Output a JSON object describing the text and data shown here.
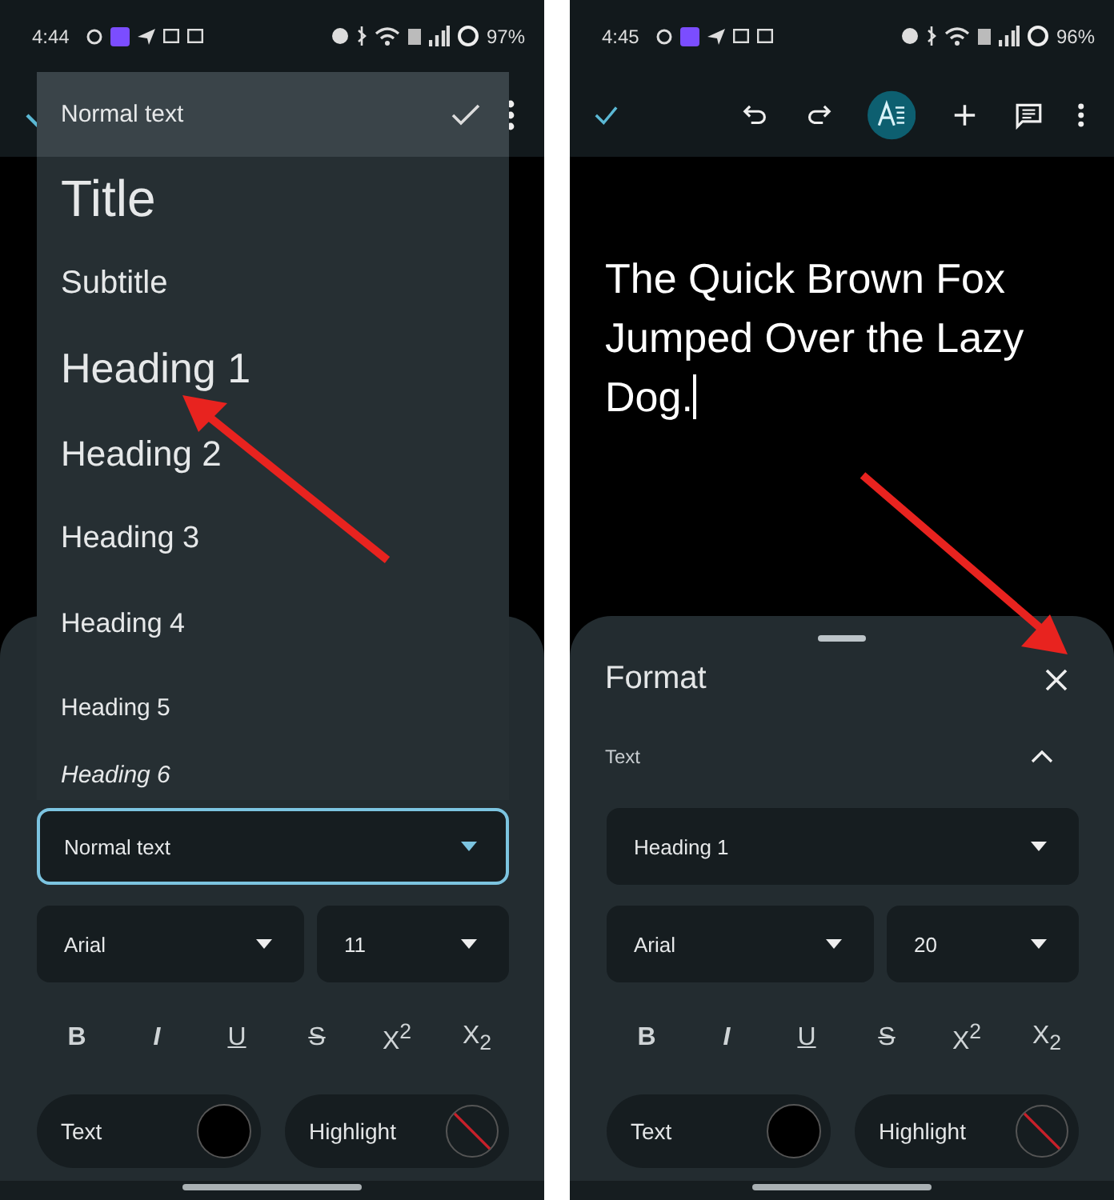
{
  "screens": [
    {
      "status_bar": {
        "time": "4:44",
        "battery": "97%"
      },
      "toolbar": {
        "kind": "covered"
      },
      "style_menu": {
        "items": [
          {
            "label": "Normal text",
            "kind": "normal",
            "selected": true
          },
          {
            "label": "Title",
            "kind": "title",
            "selected": false
          },
          {
            "label": "Subtitle",
            "kind": "subtitle",
            "selected": false
          },
          {
            "label": "Heading 1",
            "kind": "h1",
            "selected": false
          },
          {
            "label": "Heading 2",
            "kind": "h2",
            "selected": false
          },
          {
            "label": "Heading 3",
            "kind": "h3",
            "selected": false
          },
          {
            "label": "Heading 4",
            "kind": "h4",
            "selected": false
          },
          {
            "label": "Heading 5",
            "kind": "h5",
            "selected": false
          },
          {
            "label": "Heading 6",
            "kind": "h6",
            "selected": false
          }
        ]
      },
      "format_sheet": {
        "style_field": {
          "value": "Normal text",
          "focused": true
        },
        "font_field": {
          "value": "Arial"
        },
        "size_field": {
          "value": "11"
        },
        "buttons": [
          {
            "label": "B",
            "kind": "bold"
          },
          {
            "label": "I",
            "kind": "italic"
          },
          {
            "label": "U",
            "kind": "underline"
          },
          {
            "label": "S",
            "kind": "strike"
          },
          {
            "label": "X$^{2}$",
            "kind": "sup"
          },
          {
            "label": "X$_{2}$",
            "kind": "sub"
          }
        ],
        "swatches": [
          {
            "label": "Text",
            "kind": "color",
            "color": "#000000"
          },
          {
            "label": "Highlight",
            "kind": "none"
          }
        ]
      }
    },
    {
      "status_bar": {
        "time": "4:45",
        "battery": "96%"
      },
      "toolbar": {
        "kind": "full"
      },
      "document": {
        "text": "The Quick Brown Fox Jumped Over the Lazy Dog."
      },
      "format_sheet": {
        "title": "Format",
        "section": {
          "label": "Text",
          "expanded": true
        },
        "style_field": {
          "value": "Heading 1",
          "focused": false
        },
        "font_field": {
          "value": "Arial"
        },
        "size_field": {
          "value": "20"
        },
        "buttons": [
          {
            "label": "B",
            "kind": "bold"
          },
          {
            "label": "I",
            "kind": "italic"
          },
          {
            "label": "U",
            "kind": "underline"
          },
          {
            "label": "S",
            "kind": "strike"
          },
          {
            "label": "X$^{2}$",
            "kind": "sup"
          },
          {
            "label": "X$_{2}$",
            "kind": "sub"
          }
        ],
        "swatches": [
          {
            "label": "Text",
            "kind": "color",
            "color": "#000000"
          },
          {
            "label": "Highlight",
            "kind": "none"
          }
        ]
      }
    }
  ]
}
